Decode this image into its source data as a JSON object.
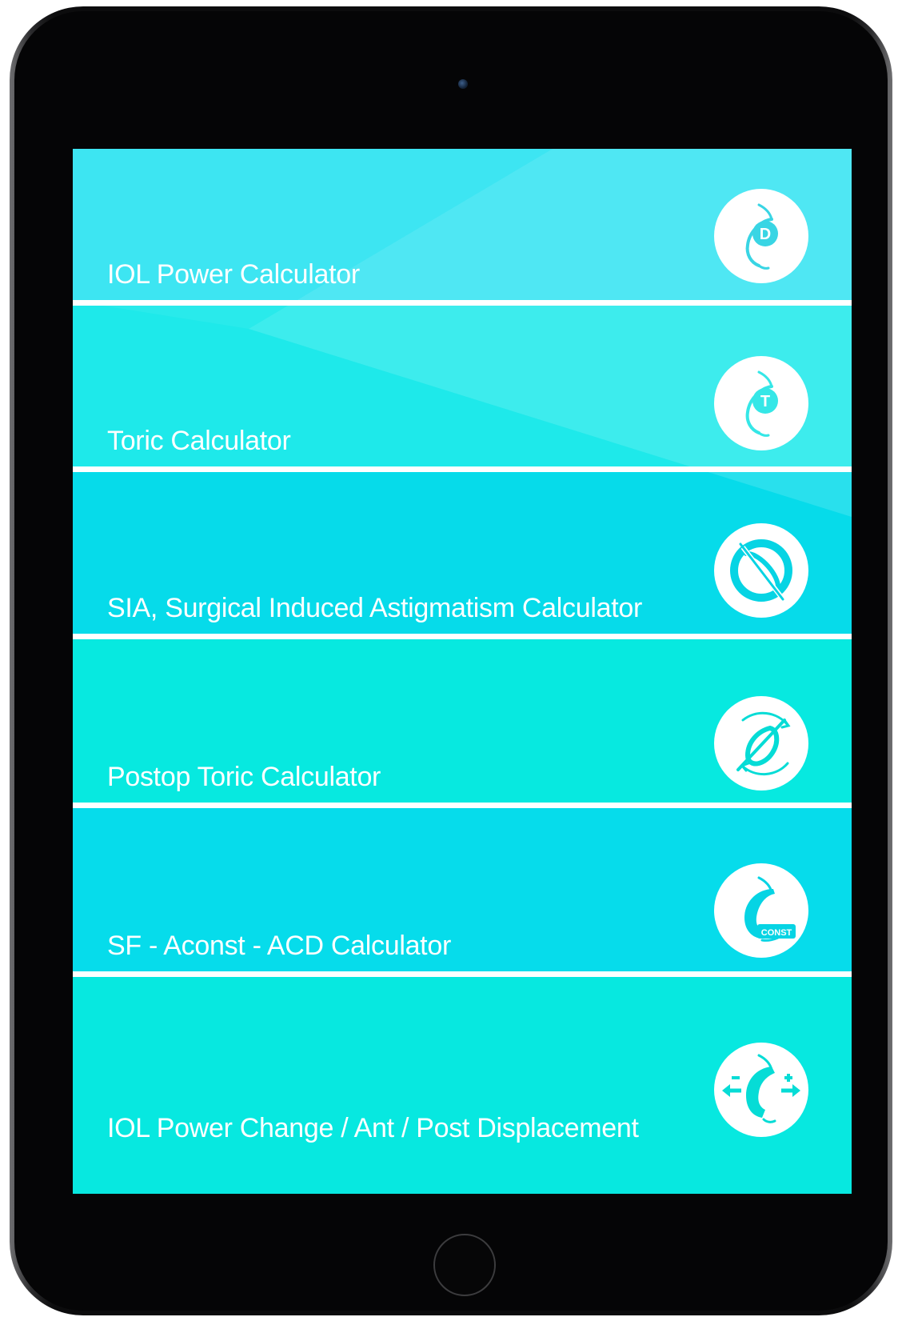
{
  "menu": {
    "items": [
      {
        "label": "IOL Power Calculator",
        "icon": "iol-power-d-icon",
        "color": "#33e4f2"
      },
      {
        "label": "Toric Calculator",
        "icon": "toric-t-icon",
        "color": "#1ee9ea"
      },
      {
        "label": "SIA, Surgical Induced Astigmatism Calculator",
        "icon": "sia-crossed-lens-icon",
        "color": "#06dbea"
      },
      {
        "label": "Postop Toric Calculator",
        "icon": "postop-toric-rotation-icon",
        "color": "#07e9e0"
      },
      {
        "label": "SF - Aconst - ACD Calculator",
        "icon": "const-lens-icon",
        "color": "#06dceb"
      },
      {
        "label": "IOL Power Change / Ant / Post Displacement",
        "icon": "displacement-arrows-icon",
        "color": "#07e8e0"
      }
    ],
    "icon_glyphs": {
      "d": "D",
      "t": "T",
      "const": "CONST"
    }
  }
}
